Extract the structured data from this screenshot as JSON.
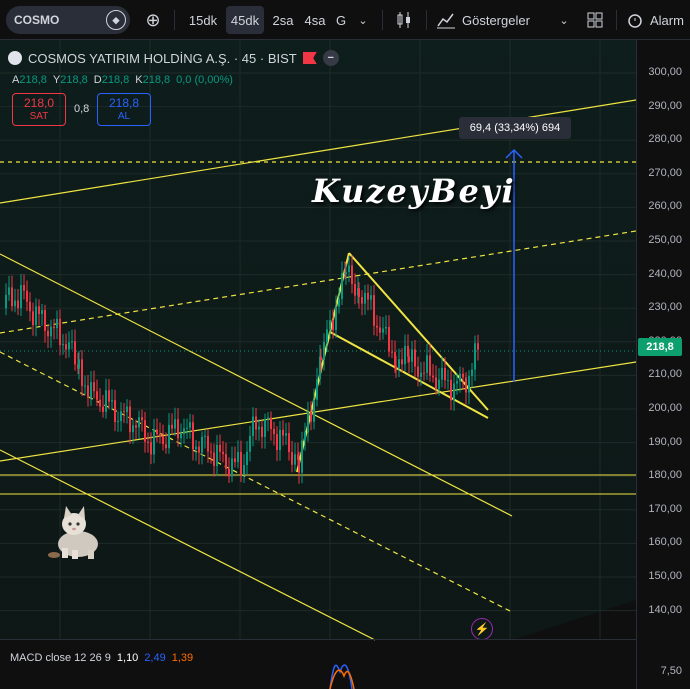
{
  "toolbar": {
    "symbol": "COSMO",
    "intervals": [
      "15dk",
      "45dk",
      "2sa",
      "4sa",
      "G"
    ],
    "active_interval": "45dk",
    "indicators_label": "Göstergeler",
    "alarm_label": "Alarm"
  },
  "legend": {
    "title": "COSMOS YATIRIM HOLDİNG A.Ş. · 45 · BIST",
    "collapse_symbol": "−",
    "ohlc": [
      {
        "k": "A",
        "v": "218,8"
      },
      {
        "k": "Y",
        "v": "218,8"
      },
      {
        "k": "D",
        "v": "218,8"
      },
      {
        "k": "K",
        "v": "218,8"
      },
      {
        "k": "",
        "v": "0,0 (0,00%)"
      }
    ]
  },
  "trade": {
    "sell_price": "218,0",
    "sell_label": "SAT",
    "spread": "0,8",
    "buy_price": "218,8",
    "buy_label": "AL"
  },
  "measure_label": "69,4 (33,34%) 694",
  "watermark": "KuzeyBeyi",
  "price_axis": {
    "ticks": [
      "300,00",
      "290,00",
      "280,00",
      "270,00",
      "260,00",
      "250,00",
      "240,00",
      "230,00",
      "220,00",
      "210,00",
      "200,00",
      "190,00",
      "180,00",
      "170,00",
      "160,00",
      "150,00",
      "140,00"
    ],
    "last_price": "218,8",
    "macd_tick": "7,50"
  },
  "macd": {
    "label": "MACD close 12 26 9",
    "v1": "1,10",
    "v2": "2,49",
    "v3": "1,39"
  },
  "colors": {
    "up": "#089981",
    "down": "#f23645",
    "trend": "#f0e442",
    "blue": "#2962ff"
  }
}
